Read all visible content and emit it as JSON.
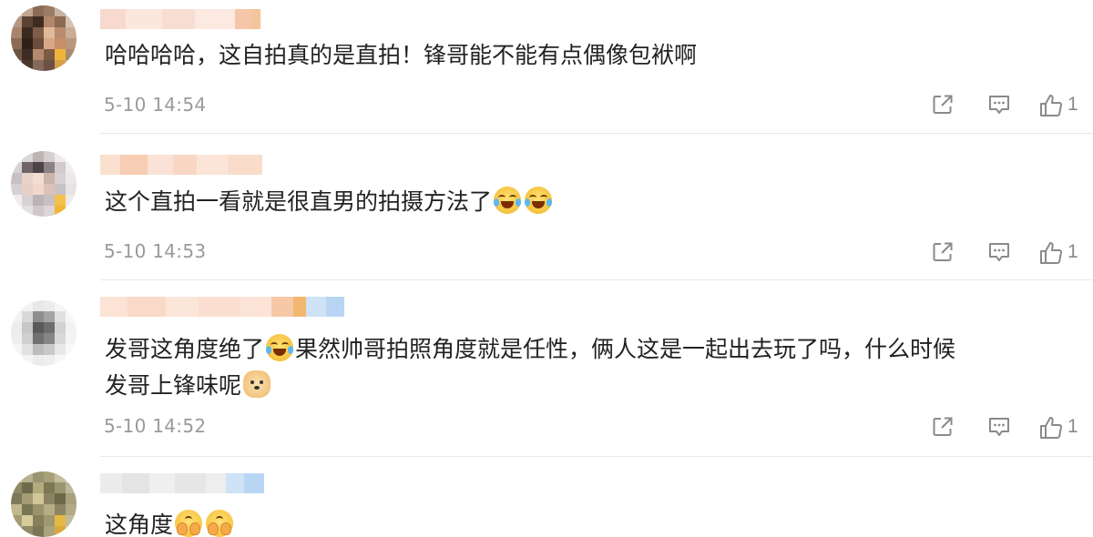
{
  "comments": [
    {
      "text": "哈哈哈哈，这自拍真的是直拍！锋哥能不能有点偶像包袱啊",
      "time": "5-10 14:54",
      "likes": "1"
    },
    {
      "text": "这个直拍一看就是很直男的拍摄方法了",
      "emojis": [
        "laugh-cry-emoji",
        "laugh-cry-emoji"
      ],
      "time": "5-10 14:53",
      "likes": "1"
    },
    {
      "text_line1_a": "发哥这角度绝了",
      "text_line1_b": "果然帅哥拍照角度就是任性，俩人这是一起出去玩了吗，什么时候",
      "text_line2": "发哥上锋味呢",
      "emojis": [
        "laugh-cry-emoji",
        "doge-emoji"
      ],
      "time": "5-10 14:52",
      "likes": "1"
    },
    {
      "text": "这角度",
      "emojis": [
        "cover-face-emoji",
        "cover-face-emoji"
      ]
    }
  ],
  "icons": {
    "share": "share-icon",
    "reply": "comment-icon",
    "like": "thumbs-up-icon"
  },
  "colors": {
    "text": "#222222",
    "meta": "#9a9a9a",
    "divider": "#e9e9e9"
  }
}
